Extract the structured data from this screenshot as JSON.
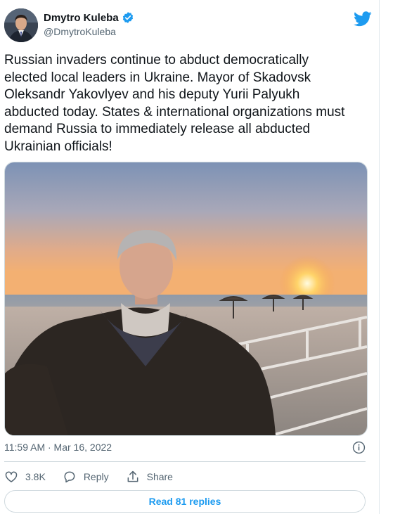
{
  "author": {
    "display_name": "Dmytro Kuleba",
    "handle": "@DmytroKuleba",
    "verified": true
  },
  "tweet": {
    "text": "Russian invaders continue to abduct democratically\nelected local leaders in Ukraine. Mayor of Skadovsk\nOleksandr Yakovlyev and his deputy Yurii Palyukh\nabducted today. States & international organizations must\ndemand Russia to immediately release all abducted\nUkrainian officials!",
    "timestamp": "11:59 AM · Mar 16, 2022",
    "media_description": "photo"
  },
  "actions": {
    "like_count": "3.8K",
    "reply_label": "Reply",
    "share_label": "Share"
  },
  "footer": {
    "read_replies_label": "Read 81 replies"
  },
  "colors": {
    "twitter_blue": "#1d9bf0",
    "text_primary": "#0f1419",
    "text_secondary": "#536471",
    "border": "#cfd9de"
  },
  "icons": [
    "verified-icon",
    "twitter-logo-icon",
    "info-icon",
    "heart-icon",
    "reply-icon",
    "share-icon"
  ]
}
